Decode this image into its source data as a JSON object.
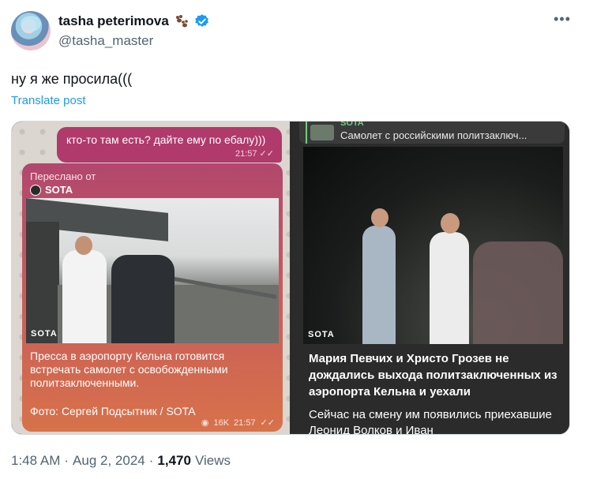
{
  "author": {
    "display_name": "tasha peterimova",
    "handle": "@tasha_master",
    "badge_emoji_icon": "paw-prints-icon",
    "verified_color": "#1d9bf0"
  },
  "post": {
    "text": "ну я же просила(((",
    "translate_label": "Translate post"
  },
  "left_image": {
    "top_message": "кто-то там есть? дайте ему по ебалу)))",
    "top_message_time": "21:57",
    "forwarded_label": "Переслано от",
    "forwarded_source": "SOTA",
    "watermark": "SOTA",
    "caption": "Пресса в аэропорту Кельна готовится встречать самолет с освобожденными политзаключенными.",
    "credit": "Фото: Сергей Подсытник / SOTA",
    "views": "16K",
    "time": "21:57"
  },
  "right_image": {
    "header_source": "SOTA",
    "header_title": "Самолет с российскими политзаключ...",
    "watermark": "SOTA",
    "caption": "Мария Певчих и Христо Грозев не дождались выхода политзаключенных из аэропорта Кельна и уехали",
    "subtext": "Сейчас на смену им появились приехавшие Леонид Волков и Иван"
  },
  "footer": {
    "time": "1:48 AM",
    "date": "Aug 2, 2024",
    "views_count": "1,470",
    "views_label": "Views",
    "separator": "·"
  }
}
